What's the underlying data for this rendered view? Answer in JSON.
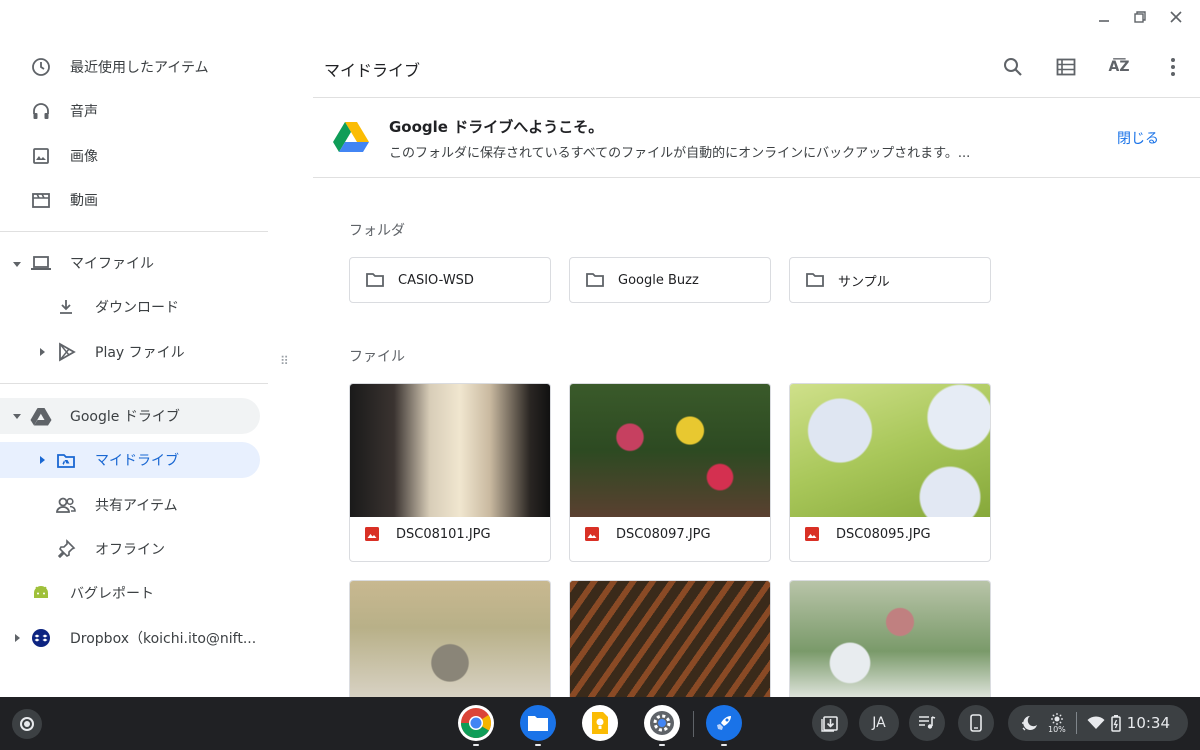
{
  "window": {
    "minimize_icon": "minimize-icon",
    "maximize_icon": "maximize-icon",
    "close_icon": "close-icon"
  },
  "sidebar": {
    "recent": "最近使用したアイテム",
    "audio": "音声",
    "images": "画像",
    "videos": "動画",
    "my_files": "マイファイル",
    "downloads": "ダウンロード",
    "play_files": "Play ファイル",
    "google_drive": "Google ドライブ",
    "my_drive": "マイドライブ",
    "shared": "共有アイテム",
    "offline": "オフライン",
    "bug_report": "バグレポート",
    "dropbox": "Dropbox（koichi.ito@nift..."
  },
  "header": {
    "title": "マイドライブ"
  },
  "banner": {
    "title": "Google ドライブへようこそ。",
    "text": "このフォルダに保存されているすべてのファイルが自動的にオンラインにバックアップされます。...",
    "close": "閉じる"
  },
  "sections": {
    "folders": "フォルダ",
    "files": "ファイル"
  },
  "folders": [
    "CASIO-WSD",
    "Google Buzz",
    "サンプル"
  ],
  "files": [
    "DSC08101.JPG",
    "DSC08097.JPG",
    "DSC08095.JPG"
  ],
  "shelf": {
    "ime": "JA",
    "battery": "10%",
    "time": "10:34"
  },
  "colors": {
    "accent": "#1a73e8",
    "selected_bg": "#e8f0fe",
    "shelf_bg": "#202124"
  }
}
